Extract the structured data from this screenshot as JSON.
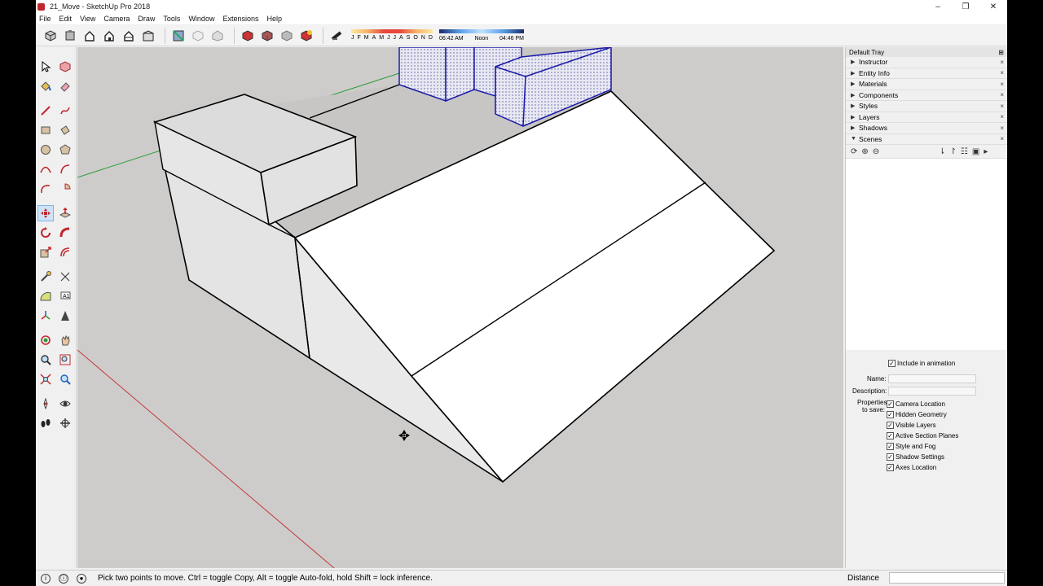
{
  "window": {
    "title": "21_Move - SketchUp Pro 2018",
    "controls": [
      "–",
      "❐",
      "✕"
    ]
  },
  "menu": [
    "File",
    "Edit",
    "View",
    "Camera",
    "Draw",
    "Tools",
    "Window",
    "Extensions",
    "Help"
  ],
  "shadow_bar": {
    "months": [
      "J",
      "F",
      "M",
      "A",
      "M",
      "J",
      "J",
      "A",
      "S",
      "O",
      "N",
      "D"
    ],
    "times": [
      "06:42 AM",
      "Noon",
      "04:46 PM"
    ]
  },
  "tray": {
    "title": "Default Tray",
    "panels": [
      {
        "label": "Instructor",
        "expanded": false
      },
      {
        "label": "Entity Info",
        "expanded": false
      },
      {
        "label": "Materials",
        "expanded": false
      },
      {
        "label": "Components",
        "expanded": false
      },
      {
        "label": "Styles",
        "expanded": false
      },
      {
        "label": "Layers",
        "expanded": false
      },
      {
        "label": "Shadows",
        "expanded": false
      },
      {
        "label": "Scenes",
        "expanded": true
      }
    ],
    "scenes": {
      "include_in_animation": "Include in animation",
      "name_label": "Name:",
      "description_label": "Description:",
      "properties_label_1": "Properties",
      "properties_label_2": "to save:",
      "properties": [
        "Camera Location",
        "Hidden Geometry",
        "Visible Layers",
        "Active Section Planes",
        "Style and Fog",
        "Shadow Settings",
        "Axes Location"
      ]
    }
  },
  "status": {
    "hint": "Pick two points to move.  Ctrl = toggle Copy, Alt = toggle Auto-fold, hold Shift = lock inference.",
    "measurement_label": "Distance",
    "measurement_value": ""
  },
  "colors": {
    "viewport_bg": "#cdcccb",
    "red_axis": "#c4373a",
    "green_axis": "#2f9b3a",
    "selection_blue": "#1a1aa8"
  }
}
